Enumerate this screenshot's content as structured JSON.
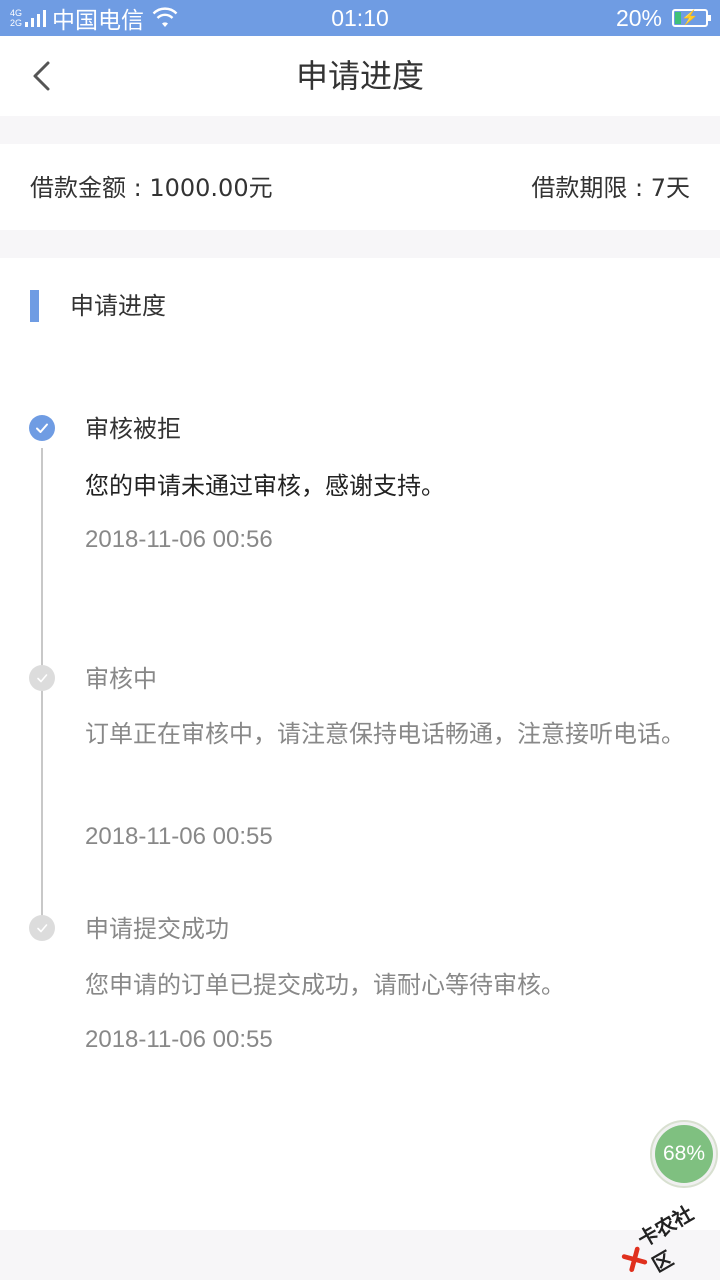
{
  "status_bar": {
    "net_top": "4G",
    "net_bottom": "2G",
    "carrier": "中国电信",
    "time": "01:10",
    "battery": "20%",
    "battery_level": 0.2
  },
  "header": {
    "title": "申请进度"
  },
  "loan": {
    "amount_label": "借款金额 : 1000.00元",
    "term_label": "借款期限 : 7天"
  },
  "progress": {
    "section_title": "申请进度",
    "steps": [
      {
        "title": "审核被拒",
        "desc": "您的申请未通过审核，感谢支持。",
        "time": "2018-11-06 00:56"
      },
      {
        "title": "审核中",
        "desc": "订单正在审核中，请注意保持电话畅通，注意接听电话。",
        "time": "2018-11-06 00:55"
      },
      {
        "title": "申请提交成功",
        "desc": "您申请的订单已提交成功，请耐心等待审核。",
        "time": "2018-11-06 00:55"
      }
    ]
  },
  "float_widget": {
    "value": "68%"
  },
  "watermark": {
    "text": "卡农社区"
  },
  "colors": {
    "accent": "#6f9ce3",
    "inactive_dot": "#dcdcdc",
    "muted_text": "#888888"
  }
}
